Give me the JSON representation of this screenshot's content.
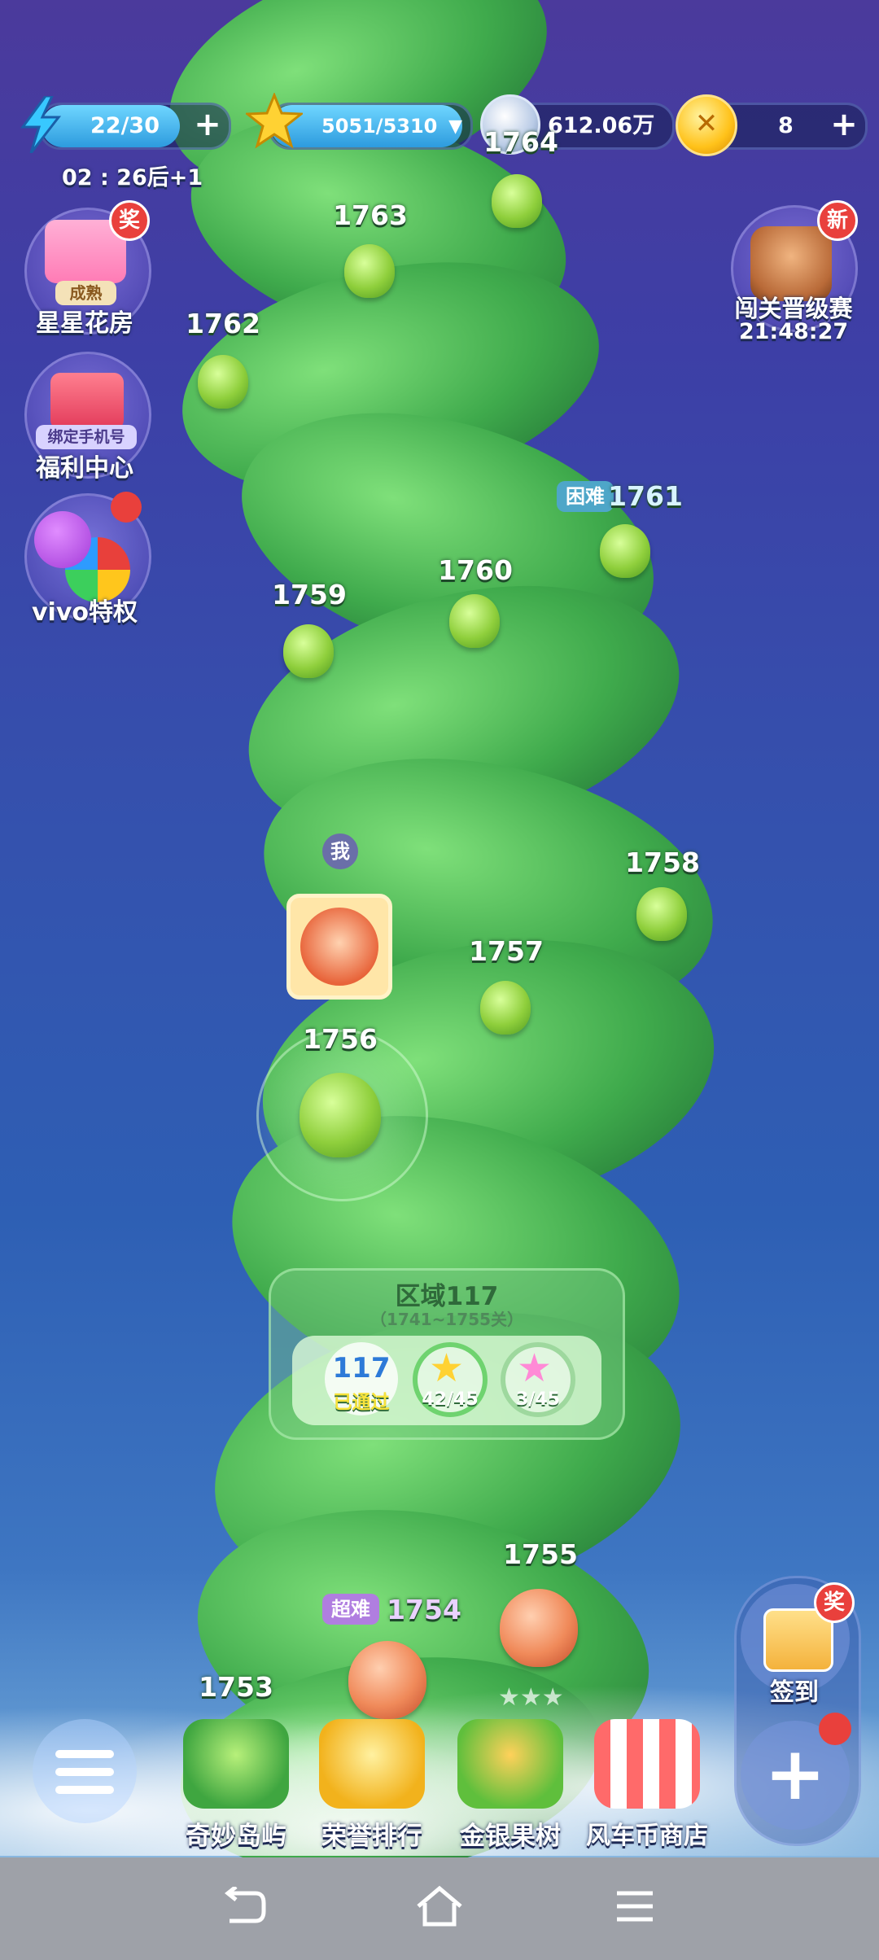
{
  "hud": {
    "energy": "22/30",
    "energy_timer": "02 : 26后+1",
    "stars": "5051/5310",
    "silver": "612.06万",
    "coins": "8"
  },
  "left_menu": {
    "flower_house": {
      "label": "星星花房",
      "tag": "成熟",
      "badge": "奖"
    },
    "welfare": {
      "label": "福利中心",
      "tag": "绑定手机号"
    },
    "vivo": {
      "label": "vivo特权"
    }
  },
  "right_menu": {
    "tournament": {
      "label": "闯关晋级赛",
      "timer": "21:48:27",
      "badge": "新"
    },
    "signin": {
      "label": "签到",
      "badge": "奖"
    }
  },
  "levels": {
    "l1764": "1764",
    "l1763": "1763",
    "l1762": "1762",
    "l1761": "1761",
    "l1761_tag": "困难",
    "l1760": "1760",
    "l1759": "1759",
    "l1758": "1758",
    "l1757": "1757",
    "l1756": "1756",
    "l1755": "1755",
    "l1754": "1754",
    "l1754_tag": "超难",
    "l1753": "1753"
  },
  "player_marker": "我",
  "region": {
    "title": "区域117",
    "subtitle": "（1741~1755关）",
    "number": "117",
    "status": "已通过",
    "stars": "42/45",
    "rainbow_stars": "3/45"
  },
  "bottom_nav": [
    {
      "label": "奇妙岛屿"
    },
    {
      "label": "荣誉排行"
    },
    {
      "label": "金银果树"
    },
    {
      "label": "风车币商店"
    }
  ],
  "colors": {
    "energy_bar": "#3fb9f0",
    "star_bar": "#3fb0ea",
    "badge_red": "#e9403c",
    "vine_green": "#3faa4c"
  }
}
